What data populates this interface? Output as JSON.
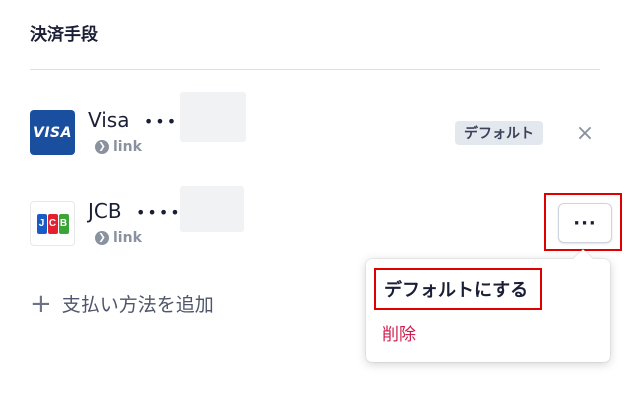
{
  "section": {
    "title": "決済手段"
  },
  "cards": [
    {
      "brand_text": "VISA",
      "name": "Visa",
      "dots": "••••",
      "link_label": "link",
      "default_label": "デフォルト"
    },
    {
      "brand_letters": [
        "J",
        "C",
        "B"
      ],
      "name": "JCB",
      "dots": "••••",
      "link_label": "link"
    }
  ],
  "actions": {
    "remove_icon": "×",
    "more_icon": "···",
    "add_method_icon": "+",
    "add_method_label": "支払い方法を追加"
  },
  "dropdown": {
    "make_default_label": "デフォルトにする",
    "delete_label": "削除"
  },
  "colors": {
    "visa_blue": "#1a4fa0",
    "jcb_blue": "#1b5cc4",
    "jcb_red": "#e2202f",
    "jcb_green": "#3aa536",
    "delete_red": "#cd1f4f",
    "highlight_red": "#e00000"
  }
}
